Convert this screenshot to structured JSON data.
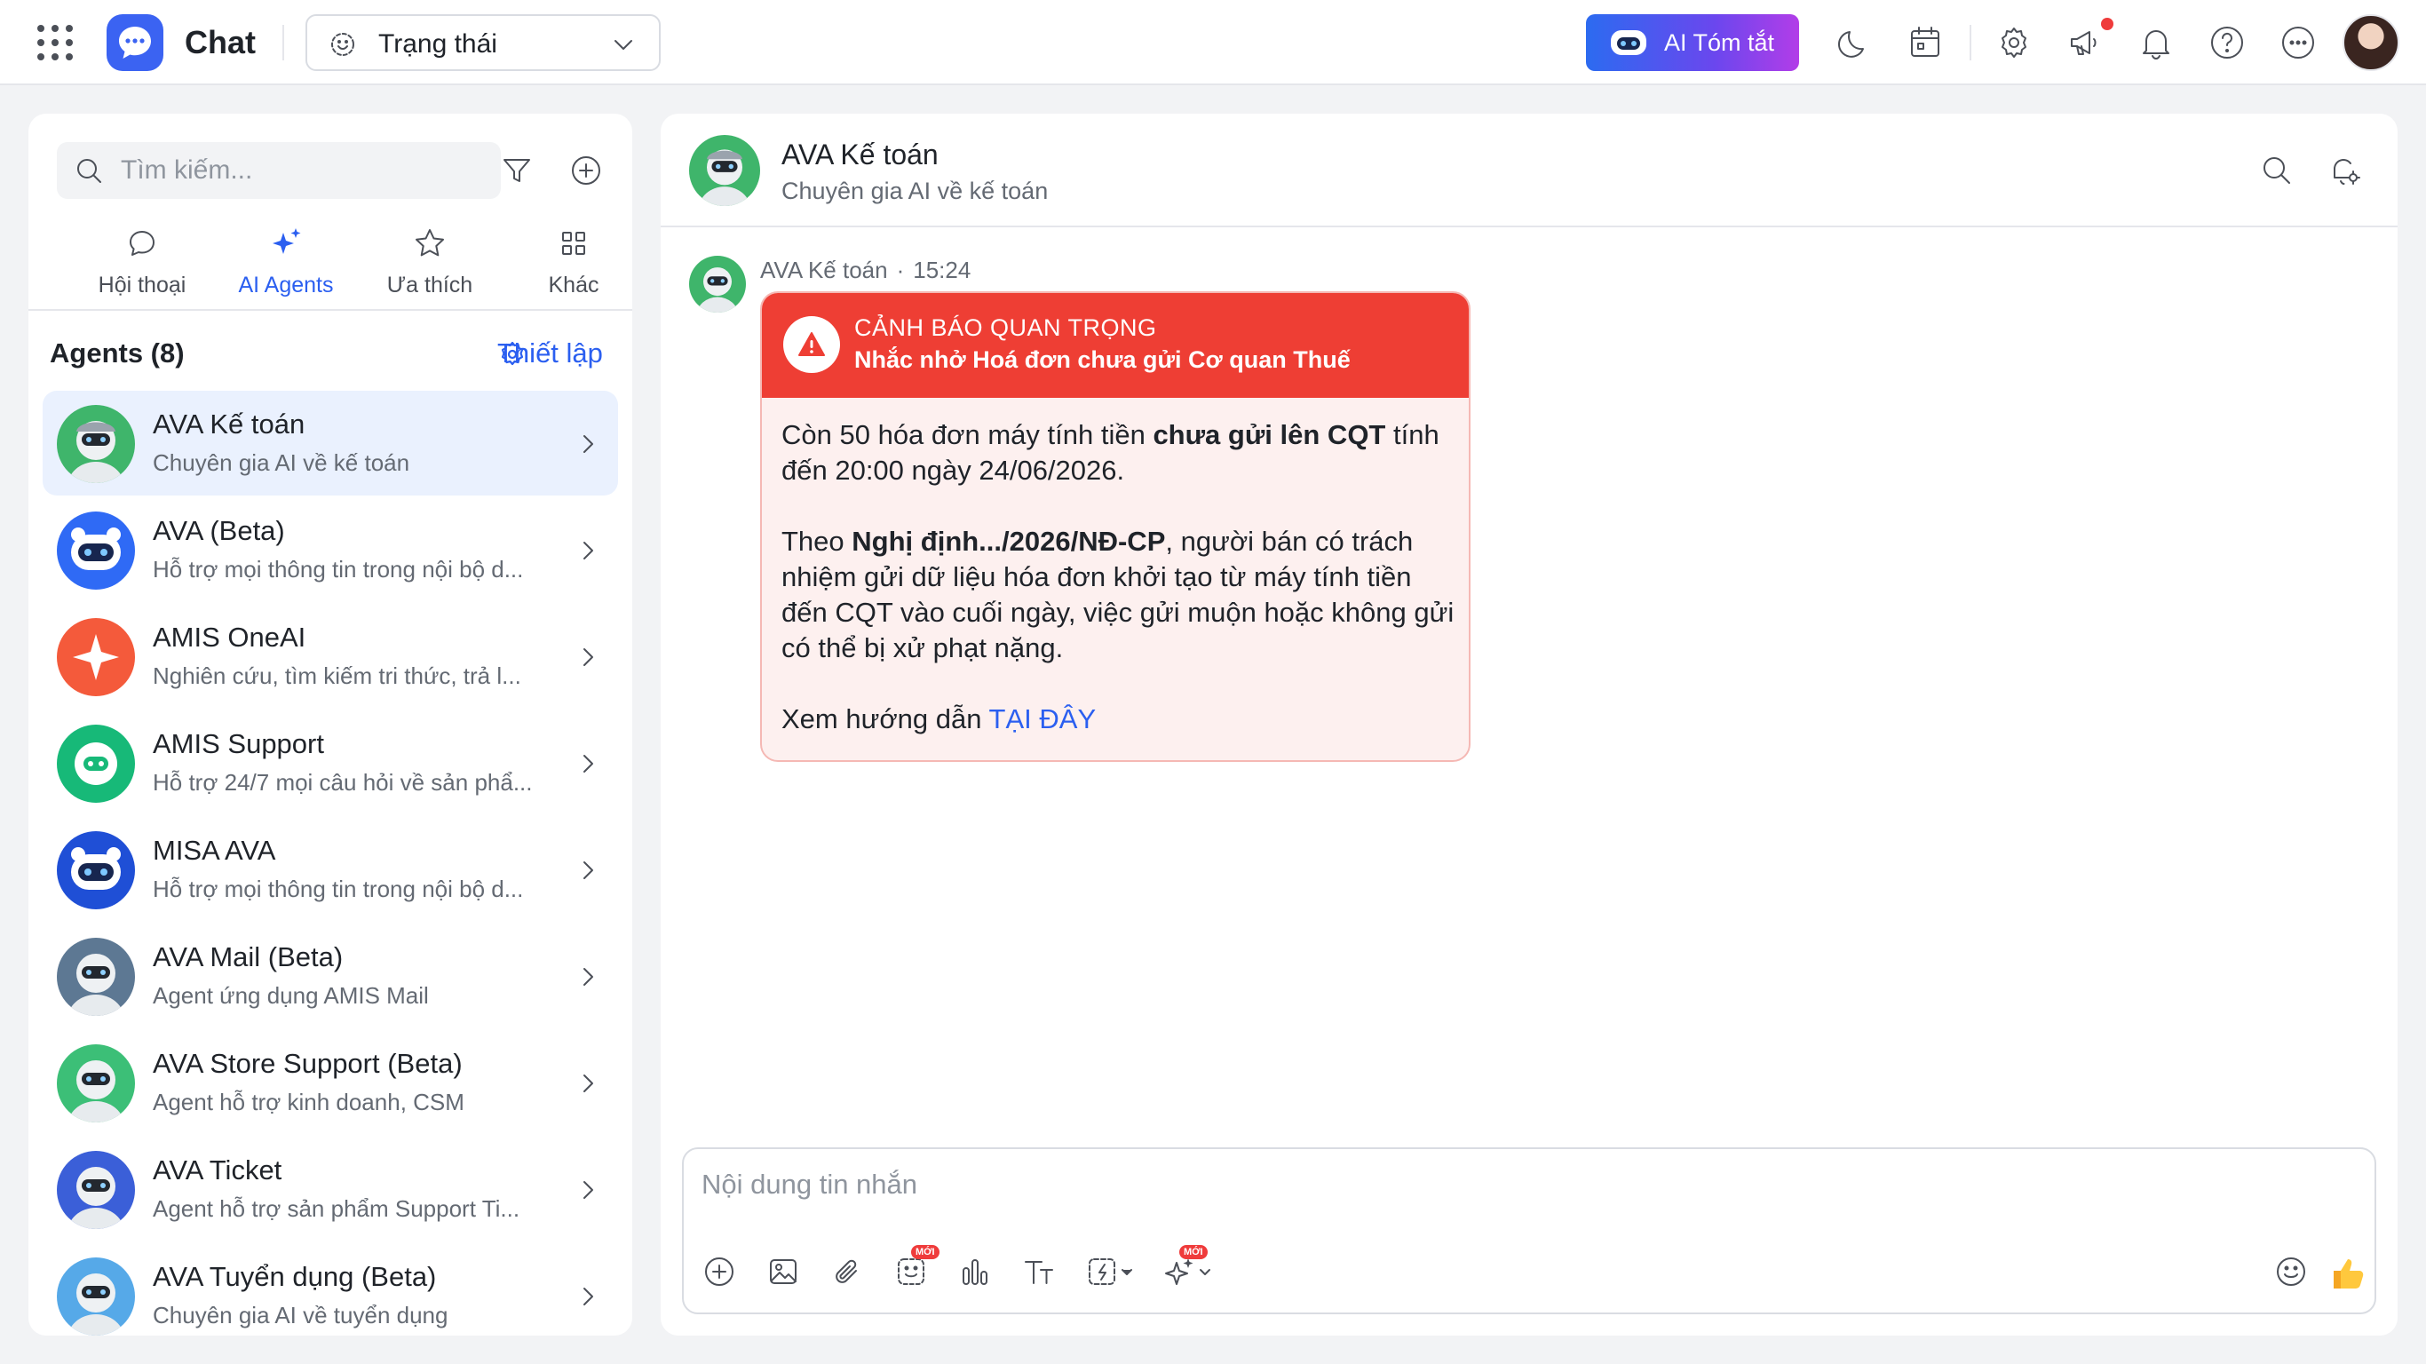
{
  "topbar": {
    "app_title": "Chat",
    "status_label": "Trạng thái",
    "ai_summary_label": "AI Tóm tắt",
    "icons": [
      "apps-grid-icon",
      "chat-logo-icon",
      "moon-icon",
      "calendar-icon",
      "settings-icon",
      "megaphone-icon",
      "bell-icon",
      "help-icon",
      "more-icon"
    ],
    "accent_gradient": [
      "#2c6bf0",
      "#6a47ee",
      "#b23de8"
    ]
  },
  "sidebar": {
    "search_placeholder": "Tìm kiếm...",
    "tabs": [
      {
        "label": "Hội thoại",
        "icon": "chat-bubble-icon"
      },
      {
        "label": "AI Agents",
        "icon": "sparkle-icon"
      },
      {
        "label": "Ưa thích",
        "icon": "star-icon"
      },
      {
        "label": "Khác",
        "icon": "grid-icon"
      }
    ],
    "active_tab": "AI Agents",
    "agents_heading": "Agents (8)",
    "setup_label": "Thiết lập",
    "agents": [
      {
        "name": "AVA Kế toán",
        "desc": "Chuyên gia AI về kế toán",
        "avatar": "robot-green"
      },
      {
        "name": "AVA (Beta)",
        "desc": "Hỗ trợ mọi thông tin trong nội bộ d...",
        "avatar": "bot-blue"
      },
      {
        "name": "AMIS OneAI",
        "desc": "Nghiên cứu, tìm kiếm tri thức, trả l...",
        "avatar": "sparkle-red"
      },
      {
        "name": "AMIS Support",
        "desc": "Hỗ trợ 24/7 mọi câu hỏi về sản phẩ...",
        "avatar": "chat-green"
      },
      {
        "name": "MISA AVA",
        "desc": "Hỗ trợ mọi thông tin trong nội bộ d...",
        "avatar": "bot-navy"
      },
      {
        "name": "AVA Mail (Beta)",
        "desc": "Agent ứng dụng AMIS Mail",
        "avatar": "robot-slate"
      },
      {
        "name": "AVA Store Support (Beta)",
        "desc": "Agent hỗ trợ kinh doanh, CSM",
        "avatar": "robot-green"
      },
      {
        "name": "AVA Ticket",
        "desc": "Agent hỗ trợ sản phẩm Support Ti...",
        "avatar": "robot-blue"
      },
      {
        "name": "AVA Tuyển dụng (Beta)",
        "desc": "Chuyên gia AI về tuyển dụng",
        "avatar": "robot-sky"
      }
    ]
  },
  "chat": {
    "agent_name": "AVA Kế toán",
    "agent_desc": "Chuyên gia AI về kế toán",
    "message": {
      "sender": "AVA Kế toán",
      "time": "15:24",
      "alert_title": "CẢNH BÁO QUAN TRỌNG",
      "alert_subtitle": "Nhắc nhở Hoá đơn chưa gửi Cơ quan Thuế",
      "p1_a": "Còn 50 hóa đơn máy tính tiền ",
      "p1_b": "chưa gửi lên CQT",
      "p1_c": " tính đến 20:00 ngày 24/06/2026.",
      "p2_a": "Theo ",
      "p2_b": "Nghị định.../2026/NĐ-CP",
      "p2_c": ", người bán có trách nhiệm gửi dữ liệu hóa đơn khởi tạo từ máy tính tiền đến CQT vào cuối ngày, việc gửi muộn hoặc không gửi có thể bị xử phạt nặng.",
      "p3_a": "Xem hướng dẫn ",
      "p3_link": "TẠI ĐÂY",
      "alert_color": "#ee3e34"
    },
    "composer_placeholder": "Nội dung tin nhắn",
    "new_badge": "MỚI"
  }
}
